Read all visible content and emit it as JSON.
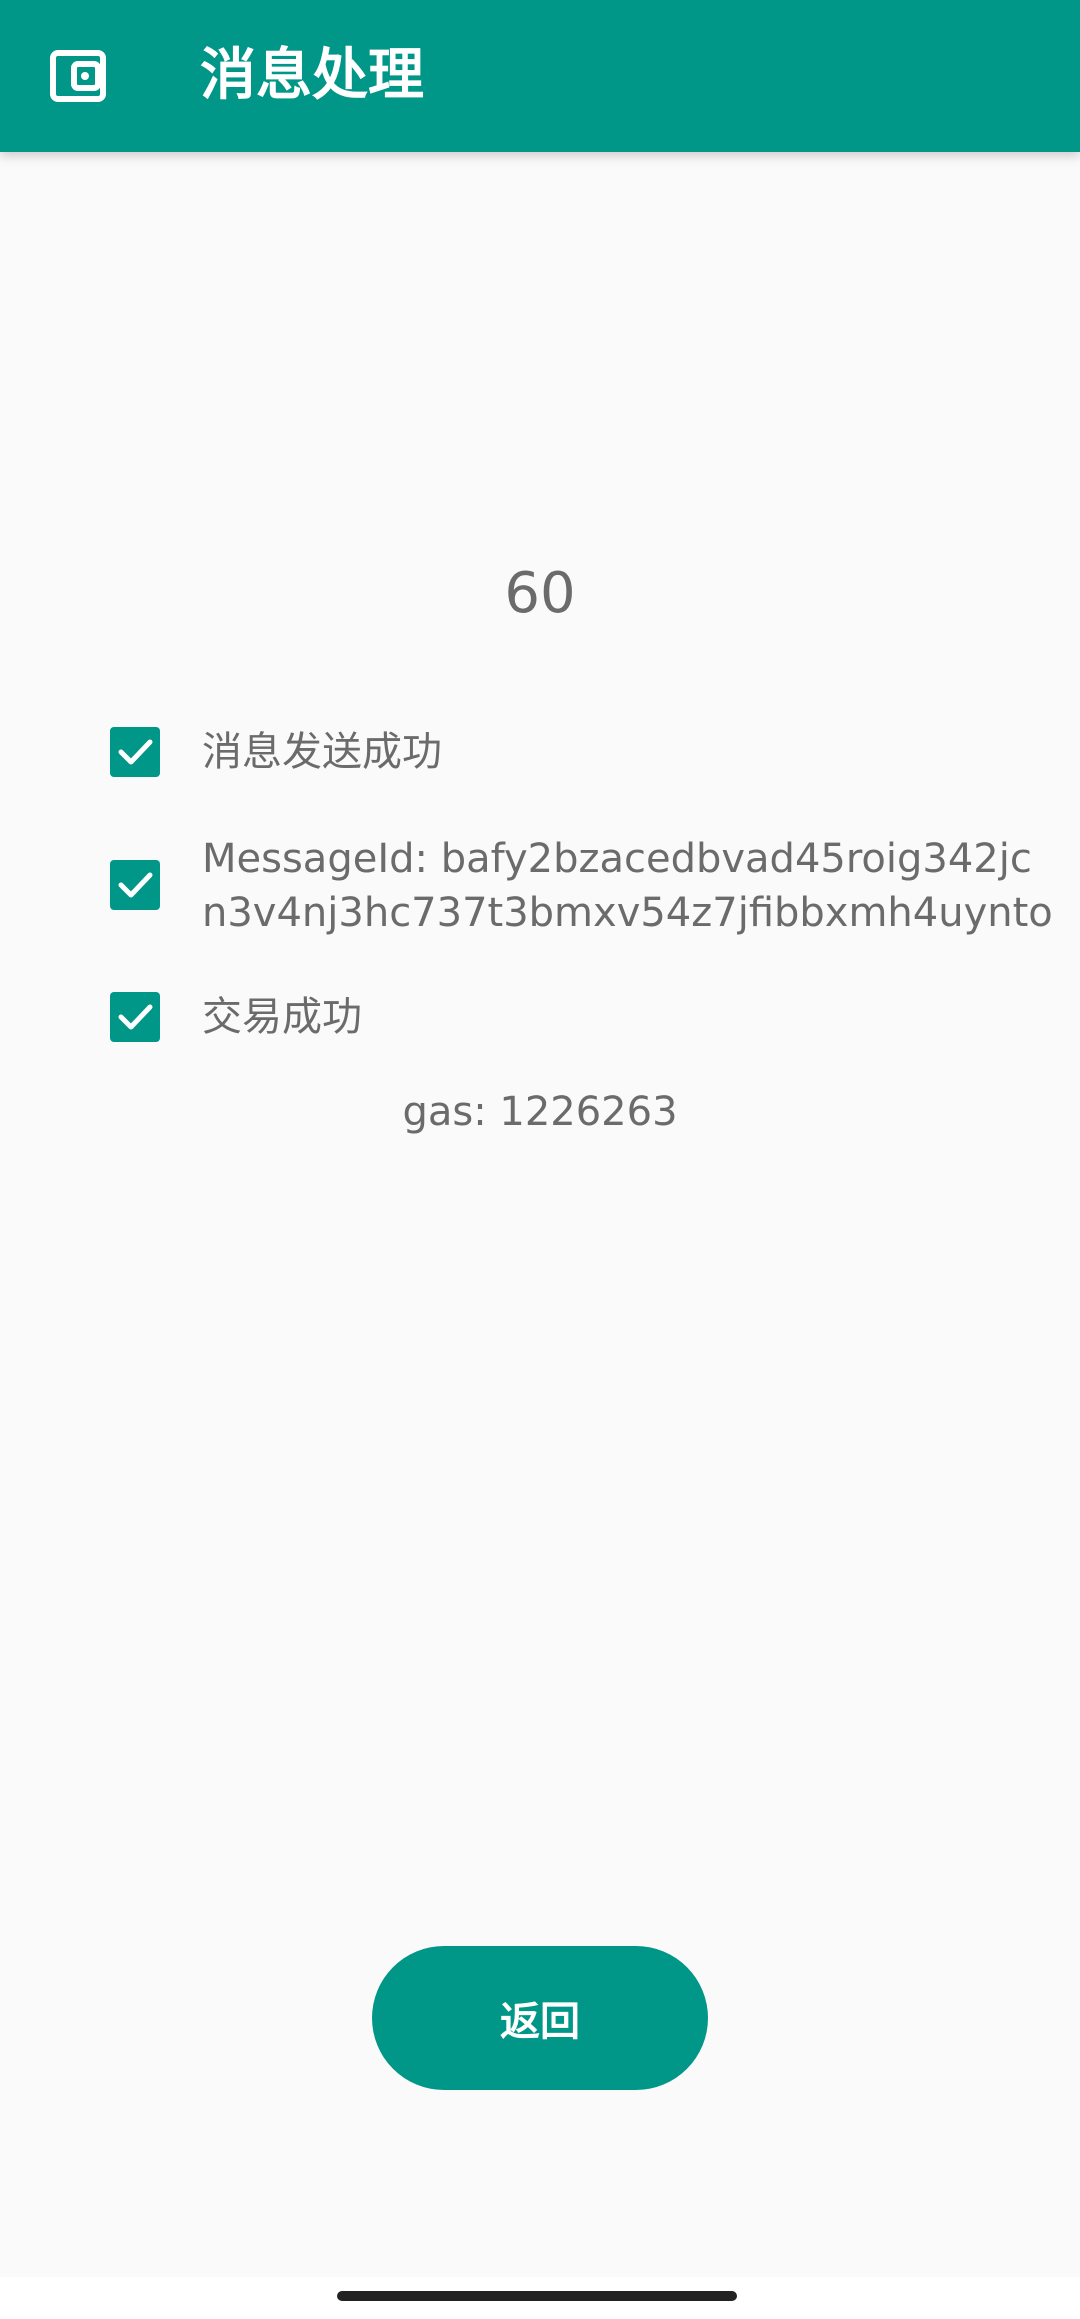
{
  "app_bar": {
    "title": "消息处理",
    "icon": "wallet-icon",
    "color": "#009688"
  },
  "countdown": "60",
  "steps": [
    {
      "label": "消息发送成功",
      "checked": true
    },
    {
      "label_line1": "MessageId: bafy2bzacedbvad45roig342jc",
      "label_line2": "n3v4nj3hc737t3bmxv54z7jfibbxmh4uynto",
      "checked": true
    },
    {
      "label": "交易成功",
      "checked": true
    }
  ],
  "gas": "gas: 1226263",
  "back_button": {
    "label": "返回"
  }
}
